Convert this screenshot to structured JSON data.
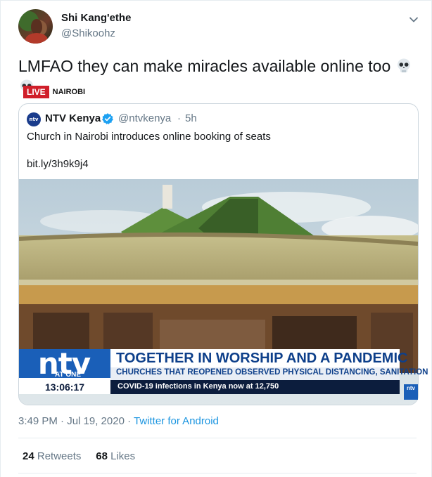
{
  "tweet": {
    "author_name": "Shi Kang'ethe",
    "author_handle": "@Shikoohz",
    "text": "LMFAO they can make miracles available online too",
    "timestamp": "3:49 PM · Jul 19, 2020",
    "meta_sep": " · ",
    "source": "Twitter for Android",
    "retweets_count": "24",
    "retweets_label": "Retweets",
    "likes_count": "68",
    "likes_label": "Likes"
  },
  "quoted_tweet": {
    "author_name": "NTV Kenya",
    "author_handle": "@ntvkenya",
    "dot": "·",
    "time": "5h",
    "text": "Church in Nairobi introduces online booking of seats",
    "link": "bit.ly/3h9k9j4",
    "logo_text": "ntv"
  },
  "broadcast": {
    "live": "LIVE",
    "location": "NAIROBI",
    "logo": "ntv",
    "program": "AT ONE",
    "clock": "13:06:17",
    "headline": "TOGETHER IN WORSHIP AND A PANDEMIC",
    "subheadline": "CHURCHES THAT REOPENED OBSERVED PHYSICAL DISTANCING, SANITATION",
    "ticker": "COVID-19 infections in Kenya now at 12,750",
    "corner_logo": "ntv"
  },
  "icons": {
    "menu": "chevron-down-icon",
    "emoji": "skull-emoji-icon",
    "verified": "verified-badge-icon"
  },
  "colors": {
    "link_blue": "#1b95e0",
    "muted": "#657786",
    "ntv_blue": "#1a5fb8",
    "live_red": "#d01f2a"
  }
}
